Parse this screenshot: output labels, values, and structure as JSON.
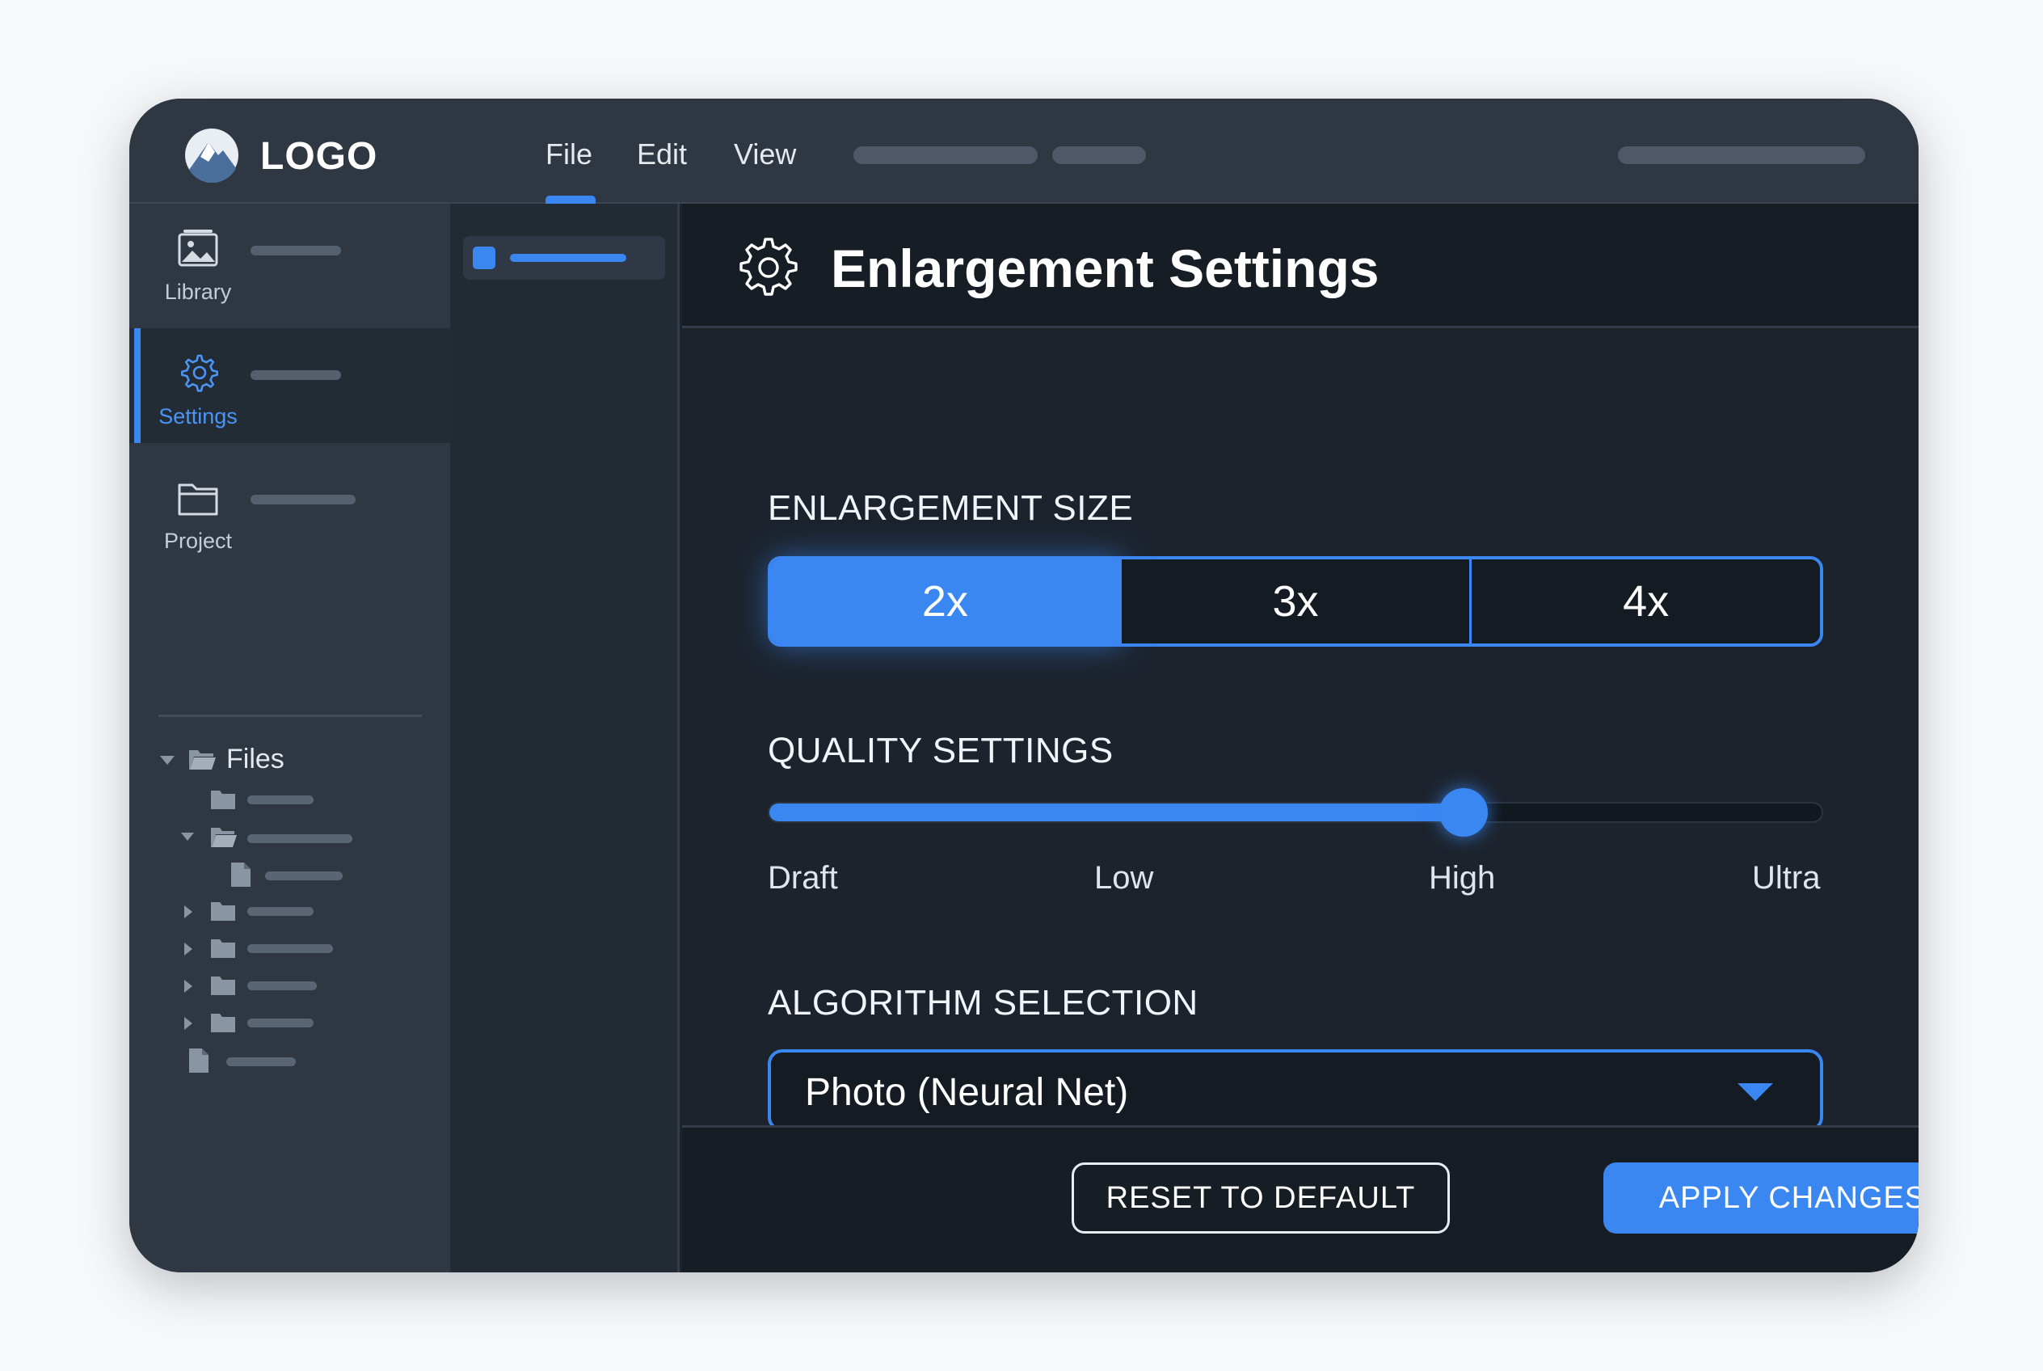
{
  "app": {
    "logo_text": "LOGO"
  },
  "menu": {
    "items": [
      "File",
      "Edit",
      "View"
    ],
    "active": "File"
  },
  "sidebar": {
    "items": [
      {
        "label": "Library",
        "icon": "image-icon"
      },
      {
        "label": "Settings",
        "icon": "gear-icon",
        "active": true
      },
      {
        "label": "Project",
        "icon": "folder-icon"
      }
    ],
    "tree_root": "Files"
  },
  "panel": {
    "title": "Enlargement Settings",
    "enlargement": {
      "label": "ENLARGEMENT SIZE",
      "options": [
        "2x",
        "3x",
        "4x"
      ],
      "selected": "2x"
    },
    "quality": {
      "label": "QUALITY SETTINGS",
      "stops": [
        "Draft",
        "Low",
        "High",
        "Ultra"
      ],
      "value": "High",
      "level_fraction": 0.66
    },
    "algorithm": {
      "label": "ALGORITHM SELECTION",
      "selected": "Photo (Neural Net)"
    },
    "buttons": {
      "reset": "RESET TO DEFAULT",
      "apply": "APPLY CHANGES"
    }
  },
  "colors": {
    "accent": "#3a87f2",
    "background": "#1c232d",
    "topbar": "#2f3742"
  }
}
